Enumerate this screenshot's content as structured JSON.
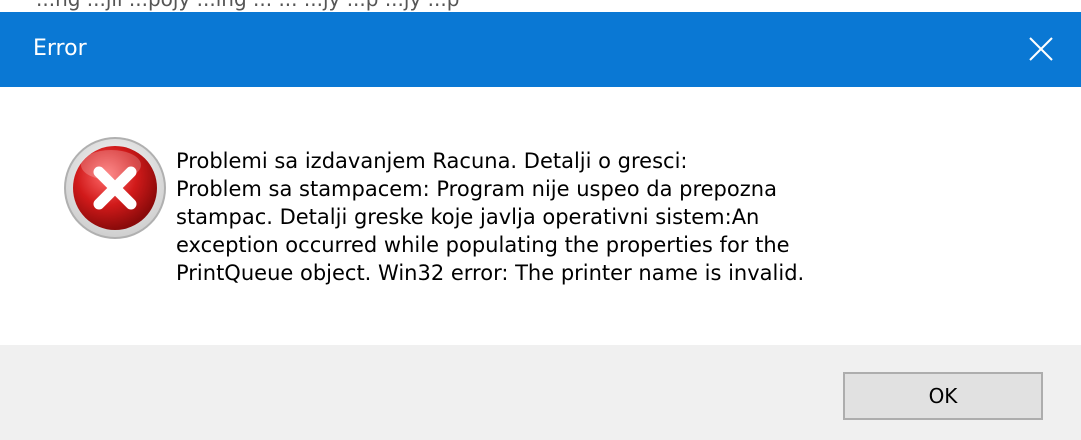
{
  "background_window": {
    "partial_text": "...ng    ...jil      ...pojy    ...lng    ...           ...   ...jy   ...p   ...jy   ...p"
  },
  "dialog": {
    "title": "Error",
    "close_icon": "close-icon",
    "status_icon": "error-icon",
    "message_lines": [
      "Problemi sa izdavanjem Racuna. Detalji o gresci:",
      "Problem sa stampacem: Program nije uspeo da prepozna",
      "stampac. Detalji greske koje javlja operativni sistem:An",
      "exception occurred while populating the properties for the",
      "PrintQueue object. Win32 error: The printer name is invalid."
    ],
    "ok_label": "OK"
  },
  "colors": {
    "titlebar": "#0a78d4",
    "footer": "#f0f0f0",
    "error_red": "#c8161d"
  }
}
